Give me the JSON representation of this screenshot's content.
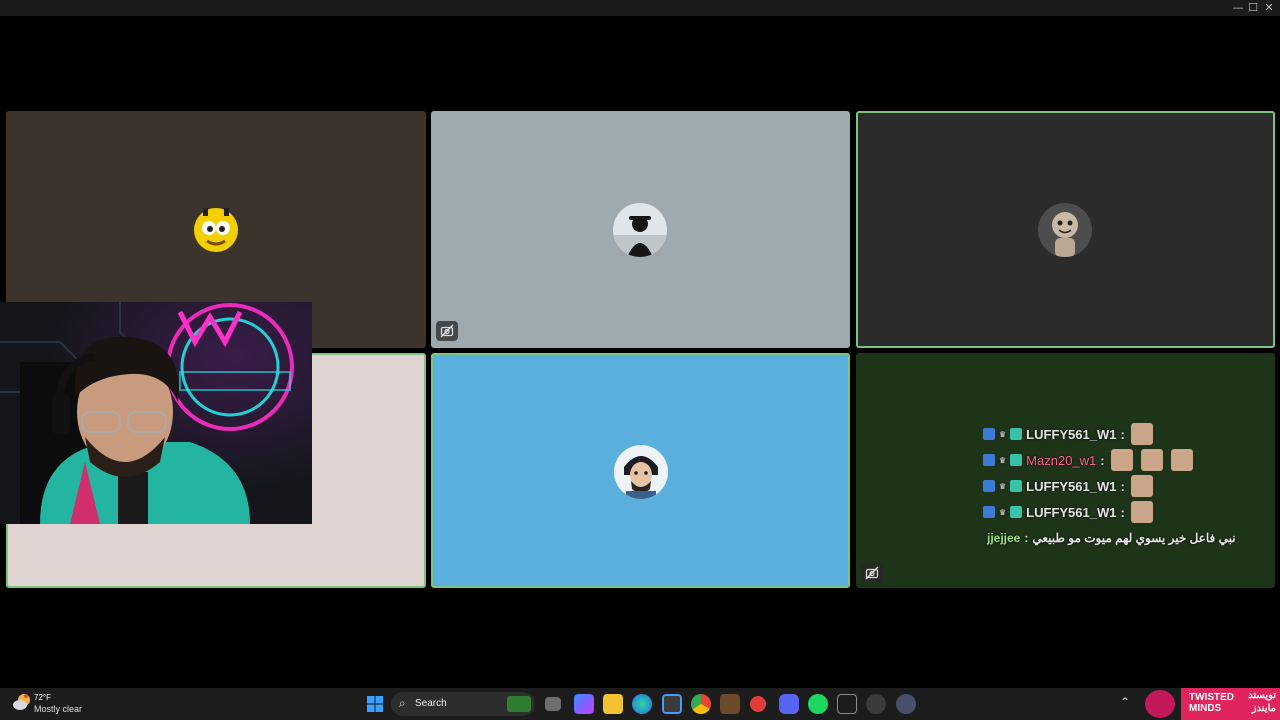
{
  "window": {
    "minimize": "—",
    "maximize": "☐",
    "close": "✕"
  },
  "tiles": [
    {
      "id": "tile-1",
      "bg": "#3c332c",
      "avatar": "yellow-monster"
    },
    {
      "id": "tile-2",
      "bg": "#9eaaaf",
      "avatar": "dark-figure",
      "muted": true
    },
    {
      "id": "tile-3",
      "bg": "#2b2b2b",
      "avatar": "sackboy",
      "speaking": true
    },
    {
      "id": "tile-4",
      "bg": "#e0d4d2",
      "speaking": true
    },
    {
      "id": "tile-5",
      "bg": "#5aafdd",
      "avatar": "cartoon-face",
      "speaking": true
    },
    {
      "id": "tile-6",
      "bg": "#1e3419",
      "muted": true
    }
  ],
  "chat": {
    "lines": [
      {
        "user": "LUFFY561_W1",
        "sep": ":",
        "user_color": "#e6e6e6",
        "emotes": 1
      },
      {
        "user": "Mazn20_w1",
        "sep": ":",
        "user_color": "#ff5f8a",
        "emotes": 3
      },
      {
        "user": "LUFFY561_W1",
        "sep": ":",
        "user_color": "#e6e6e6",
        "emotes": 1
      },
      {
        "user": "LUFFY561_W1",
        "sep": ":",
        "user_color": "#e6e6e6",
        "emotes": 1
      }
    ],
    "last": {
      "user": "jjejjee",
      "sep": ":",
      "message": "نبي فاعل خير يسوي لهم ميوت مو طبيعي",
      "user_color": "#9fe07a"
    }
  },
  "weather": {
    "temp": "72°F",
    "desc": "Mostly clear"
  },
  "taskbar": {
    "search_placeholder": "Search"
  },
  "brand": {
    "en_line1": "TWISTED",
    "en_line2": "MINDS",
    "ar_line1": "تويستد",
    "ar_line2": "مايندز"
  },
  "colors": {
    "speaking_border": "#7ec47e",
    "brand": "#e0245e"
  }
}
